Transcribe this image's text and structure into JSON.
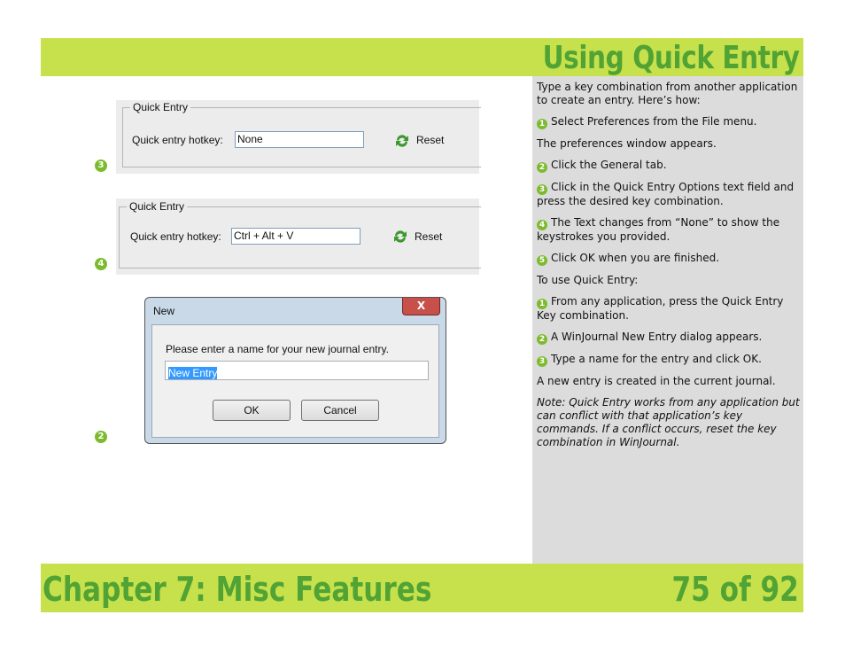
{
  "header": {
    "title": "Using Quick Entry"
  },
  "shot3": {
    "legend": "Quick Entry",
    "label": "Quick entry hotkey:",
    "value": "None",
    "reset": "Reset",
    "marker": "3"
  },
  "shot4": {
    "legend": "Quick Entry",
    "label": "Quick entry hotkey:",
    "value": "Ctrl + Alt + V",
    "reset": "Reset",
    "marker": "4"
  },
  "dialog": {
    "title": "New",
    "close": "X",
    "prompt": "Please enter a name for your new journal entry.",
    "input_value": "New Entry",
    "ok": "OK",
    "cancel": "Cancel",
    "marker": "2"
  },
  "panel": {
    "intro": "Type a key combination from another application to create an entry. Here’s how:",
    "steps1": [
      {
        "num": "1",
        "text": "Select Preferences from the File menu."
      }
    ],
    "mid1": "The preferences window appears.",
    "steps2": [
      {
        "num": "2",
        "text": "Click the General tab."
      },
      {
        "num": "3",
        "text": "Click in the Quick Entry Options text field and press the desired key combination."
      },
      {
        "num": "4",
        "text": "The Text changes from “None” to show the keystrokes you provided."
      },
      {
        "num": "5",
        "text": "Click OK when you are finished."
      }
    ],
    "use_heading": "To use Quick Entry:",
    "steps3": [
      {
        "num": "1",
        "text": "From any application, press the Quick Entry Key combination."
      },
      {
        "num": "2",
        "text": "A WinJournal New Entry dialog appears."
      },
      {
        "num": "3",
        "text": "Type a name for the entry and click OK."
      }
    ],
    "result": "A new entry is created in the current journal.",
    "note": "Note: Quick Entry works from any application but can conflict with that application’s key commands. If a conflict occurs, reset the key combination in WinJournal."
  },
  "footer": {
    "chapter": "Chapter 7: Misc Features",
    "page": "75 of 92"
  },
  "colors": {
    "band": "#c6e14b",
    "title": "#50a334",
    "panel": "#dcdcdc",
    "marker": "#7dbb2e"
  }
}
